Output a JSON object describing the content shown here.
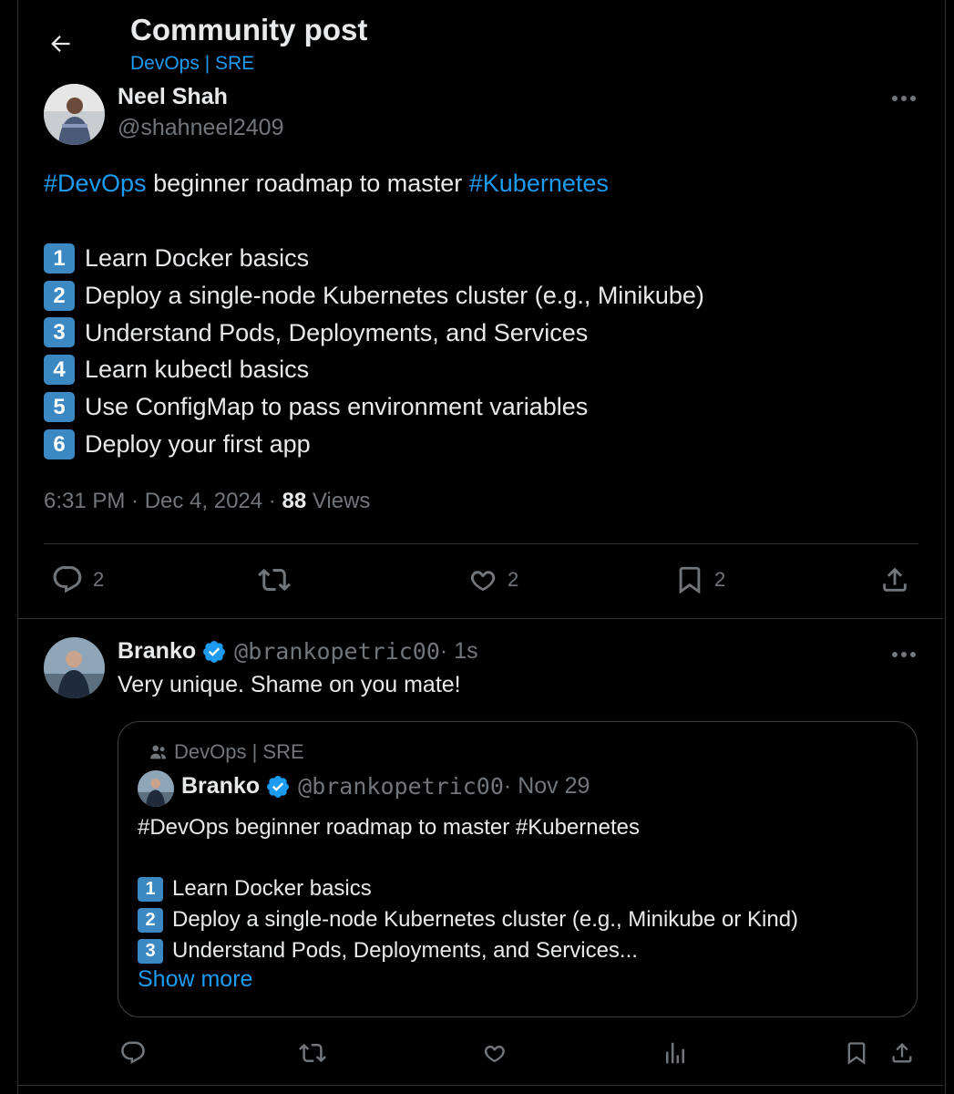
{
  "header": {
    "title": "Community post",
    "community": "DevOps | SRE"
  },
  "post": {
    "author_name": "Neel Shah",
    "author_handle": "@shahneel2409",
    "intro_hashtag1": "#DevOps",
    "intro_text": " beginner roadmap to master ",
    "intro_hashtag2": "#Kubernetes",
    "steps": [
      {
        "num": "1",
        "text": "Learn Docker basics"
      },
      {
        "num": "2",
        "text": "Deploy a single-node Kubernetes cluster (e.g., Minikube)"
      },
      {
        "num": "3",
        "text": "Understand Pods, Deployments, and Services"
      },
      {
        "num": "4",
        "text": "Learn kubectl basics"
      },
      {
        "num": "5",
        "text": "Use ConfigMap to pass environment variables"
      },
      {
        "num": "6",
        "text": "Deploy your first app"
      }
    ],
    "timestamp": "6:31 PM · Dec 4, 2024 · ",
    "views_count": "88",
    "views_label": " Views",
    "actions": {
      "replies": "2",
      "likes": "2",
      "bookmarks": "2"
    }
  },
  "reply": {
    "author_name": "Branko",
    "author_handle": "@brankopetric00",
    "time": " · 1s",
    "text": "Very unique. Shame on you mate!",
    "quote": {
      "community": "DevOps | SRE",
      "author_name": "Branko",
      "author_handle": "@brankopetric00",
      "date": " · Nov 29",
      "intro": "#DevOps beginner roadmap to master #Kubernetes",
      "steps": [
        {
          "num": "1",
          "text": "Learn Docker basics"
        },
        {
          "num": "2",
          "text": "Deploy a single-node Kubernetes cluster (e.g., Minikube or Kind)"
        },
        {
          "num": "3",
          "text": "Understand Pods, Deployments, and Services..."
        }
      ],
      "show_more": "Show more"
    }
  },
  "colors": {
    "background": "#000000",
    "text": "#e7e9ea",
    "muted": "#71767b",
    "accent": "#1d9bf0",
    "verified": "#1d9bf0",
    "keycap": "#3b88c3"
  }
}
